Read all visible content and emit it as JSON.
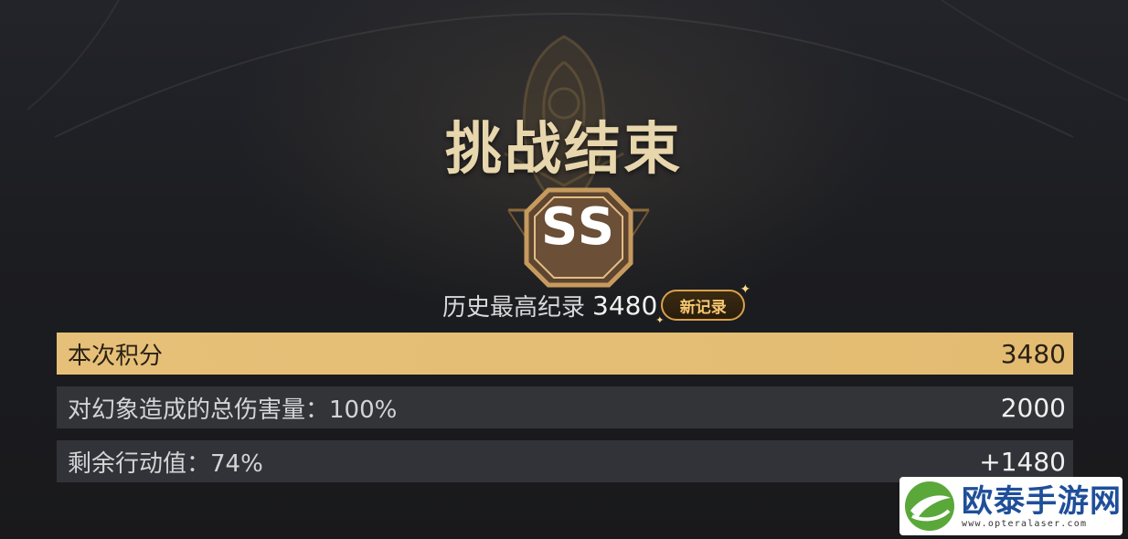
{
  "result": {
    "title": "挑战结束",
    "rank": "SS",
    "record_label": "历史最高纪录",
    "record_value": "3480",
    "new_record_badge": "新记录"
  },
  "score_rows": [
    {
      "label": "本次积分",
      "value": "3480",
      "highlight": true
    },
    {
      "label": "对幻象造成的总伤害量：100%",
      "value": "2000",
      "highlight": false
    },
    {
      "label": "剩余行动值：74%",
      "value": "+1480",
      "highlight": false
    }
  ],
  "watermark": {
    "name": "欧泰手游网",
    "url": "www.opteralaser.com"
  },
  "colors": {
    "gold": "#e6c078",
    "title_gold": "#e8d6ad",
    "badge_bronze": "#b58a54",
    "row_bg": "#3a3b40",
    "background": "#1c1d21",
    "watermark_blue": "#1f4f9a",
    "watermark_green": "#5aa83a"
  },
  "icons": {
    "emblem": "hooded-figure-emblem",
    "rank_frame": "octagon-rank-frame",
    "sparkle": "sparkle-icon",
    "watermark_logo": "leaf-swoosh-logo"
  }
}
